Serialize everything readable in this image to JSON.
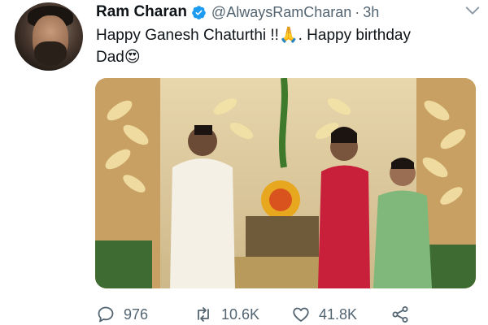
{
  "tweet": {
    "author_name": "Ram Charan",
    "handle": "@AlwaysRamCharan",
    "separator": "·",
    "time": "3h",
    "text_line1": "Happy Ganesh Chaturthi !!🙏. Happy birthday",
    "text_line2": "Dad😍",
    "avatar_icon": "profile-photo",
    "verified_icon": "verified-badge-icon",
    "menu_icon": "chevron-down-icon"
  },
  "actions": {
    "reply_count": "976",
    "retweet_count": "10.6K",
    "like_count": "41.8K",
    "reply_icon": "reply-icon",
    "retweet_icon": "retweet-icon",
    "like_icon": "heart-icon",
    "share_icon": "share-icon"
  },
  "colors": {
    "verified": "#1d9bf0",
    "secondary_text": "#536471",
    "primary_text": "#0f1419"
  }
}
